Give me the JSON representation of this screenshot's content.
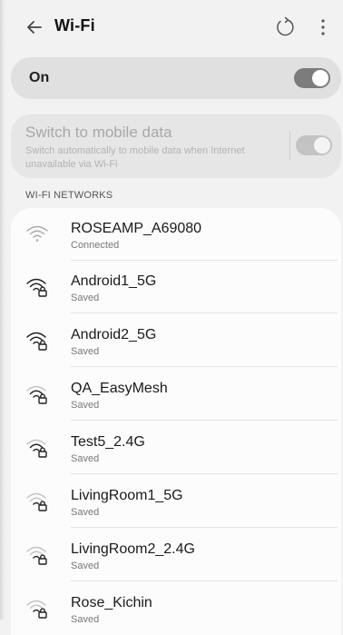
{
  "header": {
    "title": "Wi-Fi",
    "back_icon": "arrow-left-icon",
    "refresh_icon": "refresh-icon",
    "more_icon": "more-vert-icon"
  },
  "wifi_toggle": {
    "label": "On",
    "state": "on"
  },
  "mobile_data": {
    "title": "Switch to mobile data",
    "description": "Switch automatically to mobile data when Internet unavailable via Wi-Fi",
    "state": "on-disabled"
  },
  "section_label": "WI-FI NETWORKS",
  "networks": [
    {
      "name": "ROSEAMP_A69080",
      "status": "Connected",
      "icon": "wifi-open-icon"
    },
    {
      "name": "Android1_5G",
      "status": "Saved",
      "icon": "wifi-locked-icon"
    },
    {
      "name": "Android2_5G",
      "status": "Saved",
      "icon": "wifi-locked-icon"
    },
    {
      "name": "QA_EasyMesh",
      "status": "Saved",
      "icon": "wifi-locked-icon"
    },
    {
      "name": "Test5_2.4G",
      "status": "Saved",
      "icon": "wifi-locked-icon"
    },
    {
      "name": "LivingRoom1_5G",
      "status": "Saved",
      "icon": "wifi-locked-icon"
    },
    {
      "name": "LivingRoom2_2.4G",
      "status": "Saved",
      "icon": "wifi-locked-icon"
    },
    {
      "name": "Rose_Kichin",
      "status": "Saved",
      "icon": "wifi-locked-icon"
    }
  ],
  "colors": {
    "background": "#f2f2f2",
    "card": "#fcfcfc",
    "toggle_on": "#7c7c7c",
    "toggle_disabled": "#c3c3c3"
  }
}
